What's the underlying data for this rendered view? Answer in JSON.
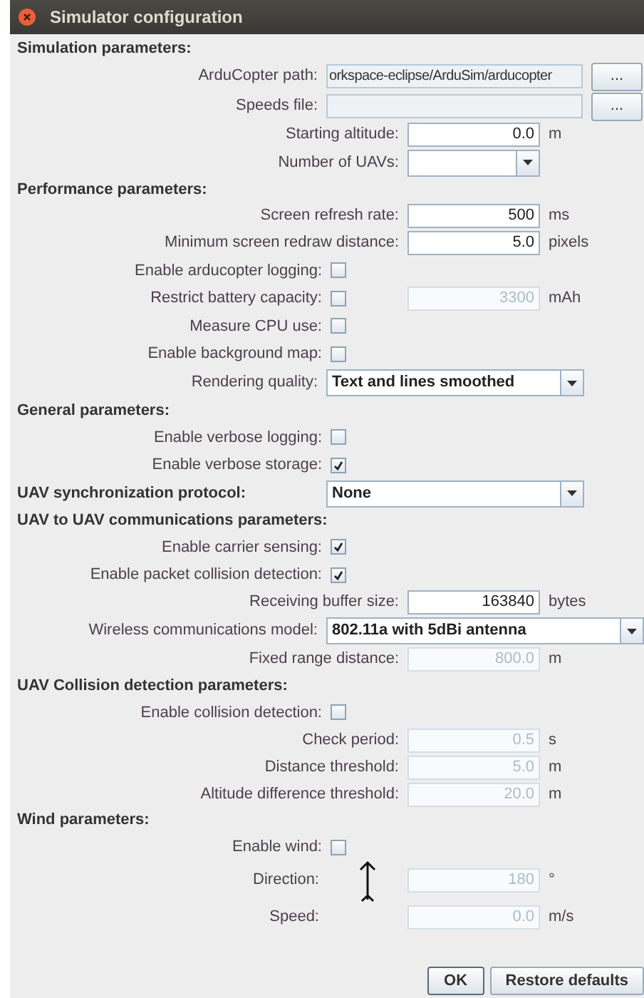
{
  "window": {
    "title": "Simulator configuration"
  },
  "rows": [
    {
      "kind": "section",
      "label": "Simulation parameters:"
    },
    {
      "kind": "path",
      "label": "ArduCopter path:",
      "value": "orkspace-eclipse/ArduSim/arducopter",
      "button": "..."
    },
    {
      "kind": "path",
      "label": "Speeds file:",
      "value": "",
      "button": "..."
    },
    {
      "kind": "field",
      "label": "Starting altitude:",
      "value": "0.0",
      "unit": "m",
      "disabled": false
    },
    {
      "kind": "small_combo",
      "label": "Number of UAVs:",
      "value": ""
    },
    {
      "kind": "section",
      "label": "Performance parameters:"
    },
    {
      "kind": "field",
      "label": "Screen refresh rate:",
      "value": "500",
      "unit": "ms",
      "disabled": false
    },
    {
      "kind": "field",
      "label": "Minimum screen redraw distance:",
      "value": "5.0",
      "unit": "pixels",
      "disabled": false
    },
    {
      "kind": "checkbox",
      "label": "Enable arducopter logging:",
      "checked": false
    },
    {
      "kind": "checkbox",
      "label": "Restrict battery capacity:",
      "checked": false,
      "value": "3300",
      "unit": "mAh",
      "disabled": true
    },
    {
      "kind": "checkbox",
      "label": "Measure CPU use:",
      "checked": false
    },
    {
      "kind": "checkbox",
      "label": "Enable background map:",
      "checked": false
    },
    {
      "kind": "combo",
      "label": "Rendering quality:",
      "value": "Text and lines smoothed"
    },
    {
      "kind": "section",
      "label": "General parameters:"
    },
    {
      "kind": "checkbox",
      "label": "Enable verbose logging:",
      "checked": false
    },
    {
      "kind": "checkbox",
      "label": "Enable verbose storage:",
      "checked": true
    },
    {
      "kind": "section_combo",
      "label": "UAV synchronization protocol:",
      "value": "None"
    },
    {
      "kind": "section",
      "label": "UAV to UAV communications parameters:"
    },
    {
      "kind": "checkbox",
      "label": "Enable carrier sensing:",
      "checked": true
    },
    {
      "kind": "checkbox",
      "label": "Enable packet collision detection:",
      "checked": true
    },
    {
      "kind": "field",
      "label": "Receiving buffer size:",
      "value": "163840",
      "unit": "bytes",
      "disabled": false
    },
    {
      "kind": "wide_combo",
      "label": "Wireless communications model:",
      "value": "802.11a with 5dBi antenna"
    },
    {
      "kind": "field",
      "label": "Fixed range distance:",
      "value": "800.0",
      "unit": "m",
      "disabled": true
    },
    {
      "kind": "section",
      "label": "UAV Collision detection parameters:"
    },
    {
      "kind": "checkbox",
      "label": "Enable collision detection:",
      "checked": false
    },
    {
      "kind": "field",
      "label": "Check period:",
      "value": "0.5",
      "unit": "s",
      "disabled": true
    },
    {
      "kind": "field",
      "label": "Distance threshold:",
      "value": "5.0",
      "unit": "m",
      "disabled": true
    },
    {
      "kind": "field",
      "label": "Altitude difference threshold:",
      "value": "20.0",
      "unit": "m",
      "disabled": true
    },
    {
      "kind": "section",
      "label": "Wind parameters:"
    },
    {
      "kind": "checkbox",
      "label": "Enable wind:",
      "checked": false
    },
    {
      "kind": "wind_direction",
      "label": "Direction:",
      "value": "180",
      "unit": "°",
      "disabled": true
    },
    {
      "kind": "wind_field",
      "label": "Speed:",
      "value": "0.0",
      "unit": "m/s",
      "disabled": true
    }
  ],
  "buttons": [
    "OK",
    "Restore defaults"
  ]
}
